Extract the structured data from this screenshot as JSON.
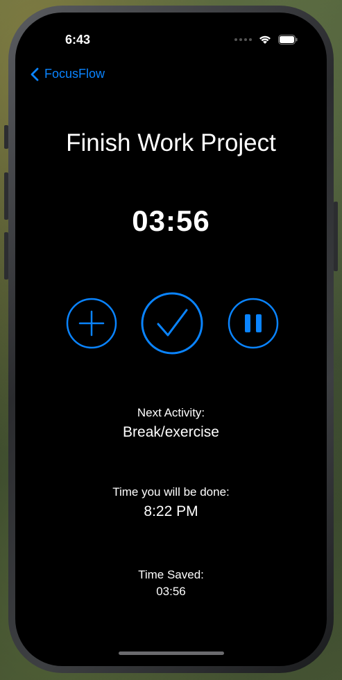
{
  "status_bar": {
    "time": "6:43",
    "icons": [
      "cellular-dots-icon",
      "wifi-icon",
      "battery-icon"
    ]
  },
  "nav": {
    "back_label": "FocusFlow",
    "back_icon": "chevron-left-icon"
  },
  "task": {
    "title": "Finish Work Project",
    "timer": "03:56"
  },
  "controls": [
    {
      "name": "add-time-button",
      "icon": "plus-icon"
    },
    {
      "name": "complete-button",
      "icon": "checkmark-icon"
    },
    {
      "name": "pause-button",
      "icon": "pause-icon"
    }
  ],
  "next_activity": {
    "label": "Next Activity:",
    "value": "Break/exercise"
  },
  "done_time": {
    "label": "Time you will be done:",
    "value": "8:22 PM"
  },
  "time_saved": {
    "label": "Time Saved:",
    "value": "03:56"
  },
  "colors": {
    "accent": "#0a84ff",
    "background": "#000000",
    "text": "#ffffff"
  }
}
